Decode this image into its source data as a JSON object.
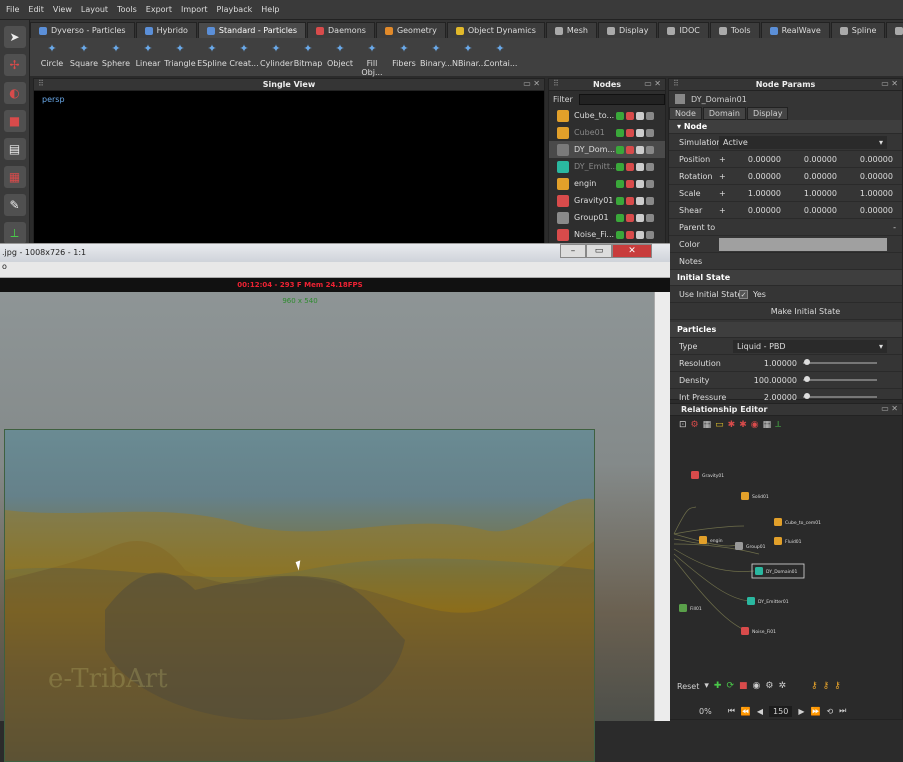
{
  "menu": [
    "File",
    "Edit",
    "View",
    "Layout",
    "Tools",
    "Export",
    "Import",
    "Playback",
    "Help"
  ],
  "tabs": [
    {
      "label": "Dyverso - Particles",
      "color": "#5b8fd8"
    },
    {
      "label": "Hybrido",
      "color": "#5b8fd8"
    },
    {
      "label": "Standard - Particles",
      "color": "#5b8fd8",
      "active": true
    },
    {
      "label": "Daemons",
      "color": "#d84b4b"
    },
    {
      "label": "Geometry",
      "color": "#e28a2a"
    },
    {
      "label": "Object Dynamics",
      "color": "#e2b92a"
    },
    {
      "label": "Mesh",
      "color": "#aaaaaa"
    },
    {
      "label": "Display",
      "color": "#aaaaaa"
    },
    {
      "label": "IDOC",
      "color": "#aaaaaa"
    },
    {
      "label": "Tools",
      "color": "#aaaaaa"
    },
    {
      "label": "RealWave",
      "color": "#5b8fd8"
    },
    {
      "label": "Spline",
      "color": "#aaaaaa"
    },
    {
      "label": "Render",
      "color": "#aaaaaa"
    }
  ],
  "shelf": [
    "Circle",
    "Square",
    "Sphere",
    "Linear",
    "Triangle",
    "ESpline",
    "Creat...",
    "Cylinder",
    "Bitmap",
    "Object",
    "Fill Obj...",
    "Fibers",
    "Binary...",
    "NBinar...",
    "Contai..."
  ],
  "single_view": {
    "title": "Single View",
    "camera": "persp"
  },
  "nodes_panel": {
    "title": "Nodes",
    "filter_label": "Filter",
    "items": [
      {
        "name": "Cube_to...",
        "color": "#e2a02a"
      },
      {
        "name": "Cube01",
        "color": "#e2a02a",
        "dim": true
      },
      {
        "name": "DY_Dom...",
        "color": "#7a7a7a",
        "selected": true
      },
      {
        "name": "DY_Emitt...",
        "color": "#2ab8a0",
        "dim": true
      },
      {
        "name": "engin",
        "color": "#e2a02a"
      },
      {
        "name": "Gravity01",
        "color": "#d84b4b"
      },
      {
        "name": "Group01",
        "color": "#8a8a8a"
      },
      {
        "name": "Noise_Fi...",
        "color": "#d84b4b"
      }
    ]
  },
  "params": {
    "title": "Node Params",
    "node_name": "DY_Domain01",
    "tabs": [
      "Node",
      "Domain",
      "Display"
    ],
    "node_section": "Node",
    "simulation_label": "Simulation",
    "simulation_value": "Active",
    "vectors": [
      {
        "label": "Position",
        "v": [
          "0.00000",
          "0.00000",
          "0.00000"
        ]
      },
      {
        "label": "Rotation",
        "v": [
          "0.00000",
          "0.00000",
          "0.00000"
        ]
      },
      {
        "label": "Scale",
        "v": [
          "1.00000",
          "1.00000",
          "1.00000"
        ]
      },
      {
        "label": "Shear",
        "v": [
          "0.00000",
          "0.00000",
          "0.00000"
        ]
      }
    ],
    "parent_label": "Parent to",
    "parent_value": "-",
    "color_label": "Color",
    "notes_label": "Notes",
    "initial_state_header": "Initial State",
    "use_initial_label": "Use Initial State",
    "use_initial_value": "Yes",
    "make_initial": "Make Initial State",
    "particles_header": "Particles",
    "type_label": "Type",
    "type_value": "Liquid - PBD",
    "scalars": [
      {
        "label": "Resolution",
        "value": "1.00000",
        "fill": 0.05
      },
      {
        "label": "Density",
        "value": "100.00000",
        "fill": 0.05
      },
      {
        "label": "Int Pressure",
        "value": "2.00000",
        "fill": 0.05
      }
    ]
  },
  "rel_editor": {
    "title": "Relationship Editor",
    "graph_nodes": [
      {
        "label": "Gravity01",
        "color": "#d84b4b"
      },
      {
        "label": "Solid01",
        "color": "#e2a02a"
      },
      {
        "label": "Cube_to_cem01",
        "color": "#e2a02a"
      },
      {
        "label": "engin",
        "color": "#e2a02a"
      },
      {
        "label": "Group01",
        "color": "#999999"
      },
      {
        "label": "Fluid01",
        "color": "#e2a02a"
      },
      {
        "label": "DY_Domain01",
        "color": "#2ab8a0"
      },
      {
        "label": "DY_Emitter01",
        "color": "#2ab8a0"
      },
      {
        "label": "Noise_Fi01",
        "color": "#d84b4b"
      },
      {
        "label": "Fill01",
        "color": "#5aa04a"
      }
    ],
    "reset_label": "Reset",
    "percent": "0%",
    "frame": "150"
  },
  "viewer": {
    "title": ".jpg - 1008x726 - 1:1",
    "sub_label": "o",
    "fps_text": "00:12:04 - 293 F Mem 24.18FPS",
    "res_text": "960 x 540",
    "watermark": "e-TribArt"
  }
}
